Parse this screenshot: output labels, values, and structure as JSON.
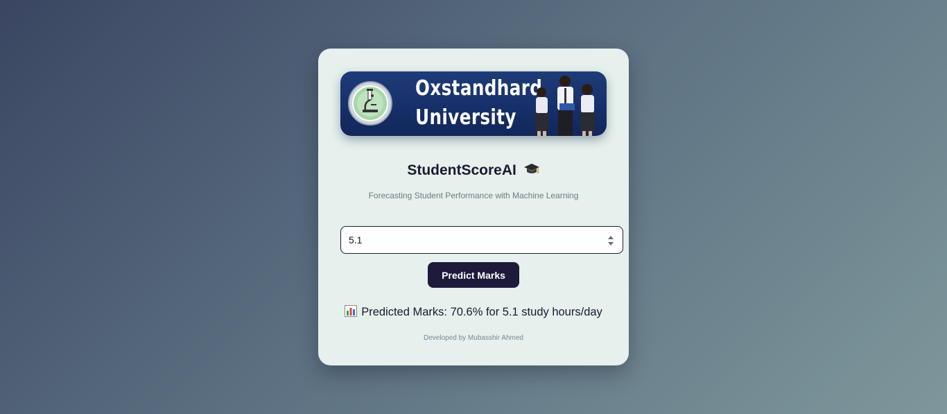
{
  "banner": {
    "university_name_line1": "Oxstandhard",
    "university_name_line2": "University",
    "logo_icon": "microscope-seal-icon",
    "image": "students-photo"
  },
  "app": {
    "title": "StudentScoreAI",
    "title_icon": "graduation-cap-icon",
    "subtitle": "Forecasting Student Performance with Machine Learning"
  },
  "form": {
    "hours_value": "5.1",
    "predict_label": "Predict Marks"
  },
  "result": {
    "icon": "bar-chart-icon",
    "text": "Predicted Marks: 70.6% for 5.1 study hours/day"
  },
  "footer": {
    "credit": "Developed by Mubasshir Ahmed"
  },
  "colors": {
    "card_bg": "#e6f0ec",
    "button_bg": "#1d1a3b",
    "banner_bg": "#1f3c78",
    "title_text": "#1a1a33"
  }
}
